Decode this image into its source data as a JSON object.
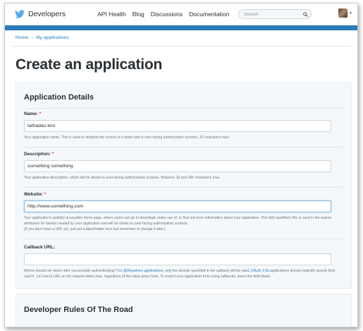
{
  "header": {
    "brand": "Developers",
    "nav": [
      "API Health",
      "Blog",
      "Discussions",
      "Documentation"
    ],
    "search_placeholder": "Search"
  },
  "breadcrumb": {
    "home": "Home",
    "arrow": "→",
    "current": "My applications"
  },
  "page_title": "Create an application",
  "details": {
    "heading": "Application Details",
    "name": {
      "label": "Name:",
      "required": "*",
      "value": "tathadas-test",
      "help": "Your application name. This is used to attribute the source of a tweet and in user-facing authorization screens. 32 characters max."
    },
    "description": {
      "label": "Description:",
      "required": "*",
      "value": "something something",
      "help": "Your application description, which will be shown in user-facing authorization screens. Between 10 and 200 characters max."
    },
    "website": {
      "label": "Website:",
      "required": "*",
      "value": "http://www.something.com",
      "help1": "Your application's publicly accessible home page, where users can go to download, make use of, or find out more information about your application. This fully-qualified URL is used in the source attribution for tweets created by your application and will be shown in user-facing authorization screens.",
      "help2": "(If you don't have a URL yet, just put a placeholder here but remember to change it later.)"
    },
    "callback": {
      "label": "Callback URL:",
      "value": "",
      "help_a": "Where should we return after successfully authenticating? For ",
      "help_link1": "@Anywhere applications",
      "help_b": ", only the domain specified in the callback will be used. ",
      "help_link2": "OAuth 1.0a",
      "help_c": " applications should explicitly specify their ",
      "help_code": "oauth_callback",
      "help_d": " URL on the request token step, regardless of the value given here. To restrict your application from using callbacks, leave this field blank."
    }
  },
  "rules": {
    "heading": "Developer Rules Of The Road"
  },
  "colors": {
    "accent": "#2b7bb9",
    "required": "#e0245e",
    "panel": "#f5f8fa"
  },
  "icons": {
    "brand": "twitter-bird-icon",
    "search": "search-icon",
    "menu": "caret-down-icon"
  }
}
